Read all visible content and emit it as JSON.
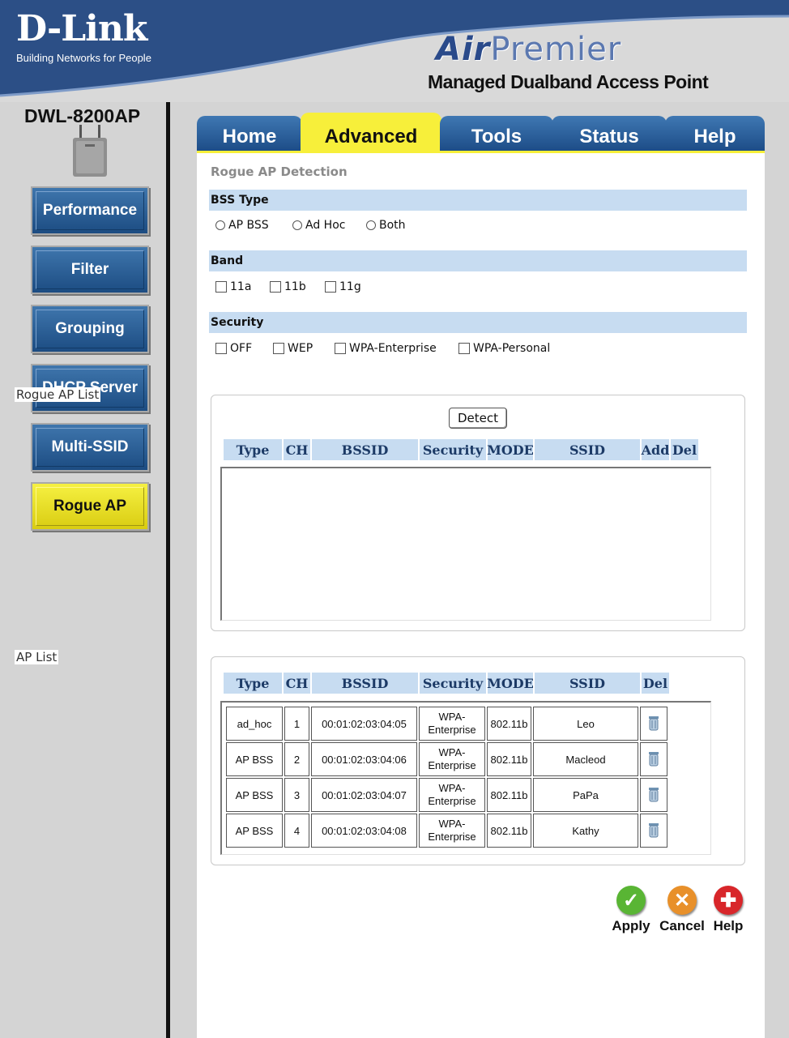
{
  "header": {
    "logo": "D-Link",
    "tagline": "Building Networks for People",
    "brand_air": "Air",
    "brand_premier": "Premier",
    "subtitle": "Managed Dualband Access Point"
  },
  "sidebar": {
    "model": "DWL-8200AP",
    "items": [
      {
        "label": "Performance"
      },
      {
        "label": "Filter"
      },
      {
        "label": "Grouping"
      },
      {
        "label": "DHCP Server"
      },
      {
        "label": "Multi-SSID"
      },
      {
        "label": "Rogue AP"
      }
    ],
    "active_index": 5
  },
  "tabs": [
    "Home",
    "Advanced",
    "Tools",
    "Status",
    "Help"
  ],
  "active_tab": "Advanced",
  "page": {
    "title": "Rogue AP Detection",
    "bss_type": {
      "label": "BSS Type",
      "options": [
        "AP BSS",
        "Ad Hoc",
        "Both"
      ]
    },
    "band": {
      "label": "Band",
      "options": [
        "11a",
        "11b",
        "11g"
      ]
    },
    "security": {
      "label": "Security",
      "options": [
        "OFF",
        "WEP",
        "WPA-Enterprise",
        "WPA-Personal"
      ]
    }
  },
  "rogue_list": {
    "title": "Rogue AP List",
    "detect_label": "Detect",
    "columns": [
      "Type",
      "CH",
      "BSSID",
      "Security",
      "MODE",
      "SSID",
      "Add",
      "Del"
    ]
  },
  "ap_list": {
    "title": "AP List",
    "columns": [
      "Type",
      "CH",
      "BSSID",
      "Security",
      "MODE",
      "SSID",
      "Del"
    ],
    "rows": [
      {
        "type": "ad_hoc",
        "ch": "1",
        "bssid": "00:01:02:03:04:05",
        "security_1": "WPA-",
        "security_2": "Enterprise",
        "mode": "802.11b",
        "ssid": "Leo"
      },
      {
        "type": "AP BSS",
        "ch": "2",
        "bssid": "00:01:02:03:04:06",
        "security_1": "WPA-",
        "security_2": "Enterprise",
        "mode": "802.11b",
        "ssid": "Macleod"
      },
      {
        "type": "AP BSS",
        "ch": "3",
        "bssid": "00:01:02:03:04:07",
        "security_1": "WPA-",
        "security_2": "Enterprise",
        "mode": "802.11b",
        "ssid": "PaPa"
      },
      {
        "type": "AP BSS",
        "ch": "4",
        "bssid": "00:01:02:03:04:08",
        "security_1": "WPA-",
        "security_2": "Enterprise",
        "mode": "802.11b",
        "ssid": "Kathy"
      }
    ]
  },
  "actions": {
    "apply": "Apply",
    "cancel": "Cancel",
    "help": "Help"
  },
  "icons": {
    "apply": "checkmark-icon",
    "cancel": "x-icon",
    "help": "plus-icon",
    "delete": "trash-icon"
  },
  "colors": {
    "header_blue": "#2c4f86",
    "nav_blue": "#1c4c82",
    "active_yellow": "#f7ef3a",
    "section_bar": "#c7dcf1",
    "apply_green": "#59b534",
    "cancel_orange": "#e8902a",
    "help_red": "#d8262a"
  }
}
